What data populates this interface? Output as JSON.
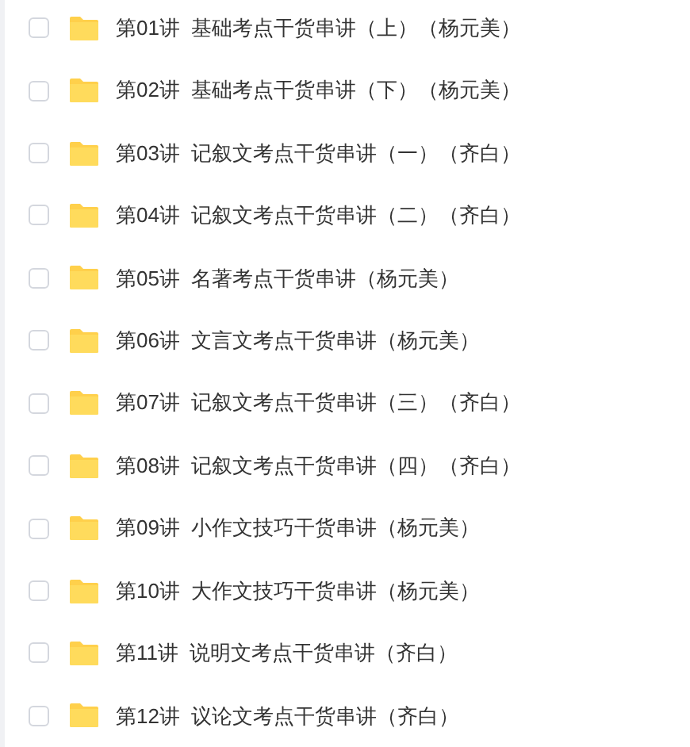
{
  "files": [
    {
      "name": "第01讲  基础考点干货串讲（上）（杨元美）",
      "checked": false
    },
    {
      "name": "第02讲  基础考点干货串讲（下）（杨元美）",
      "checked": false
    },
    {
      "name": "第03讲  记叙文考点干货串讲（一）（齐白）",
      "checked": false
    },
    {
      "name": "第04讲  记叙文考点干货串讲（二）（齐白）",
      "checked": false
    },
    {
      "name": "第05讲  名著考点干货串讲（杨元美）",
      "checked": false
    },
    {
      "name": "第06讲  文言文考点干货串讲（杨元美）",
      "checked": false
    },
    {
      "name": "第07讲  记叙文考点干货串讲（三）（齐白）",
      "checked": false
    },
    {
      "name": "第08讲  记叙文考点干货串讲（四）（齐白）",
      "checked": false
    },
    {
      "name": "第09讲  小作文技巧干货串讲（杨元美）",
      "checked": false
    },
    {
      "name": "第10讲  大作文技巧干货串讲（杨元美）",
      "checked": false
    },
    {
      "name": "第11讲  说明文考点干货串讲（齐白）",
      "checked": false
    },
    {
      "name": "第12讲  议论文考点干货串讲（齐白）",
      "checked": false
    }
  ]
}
